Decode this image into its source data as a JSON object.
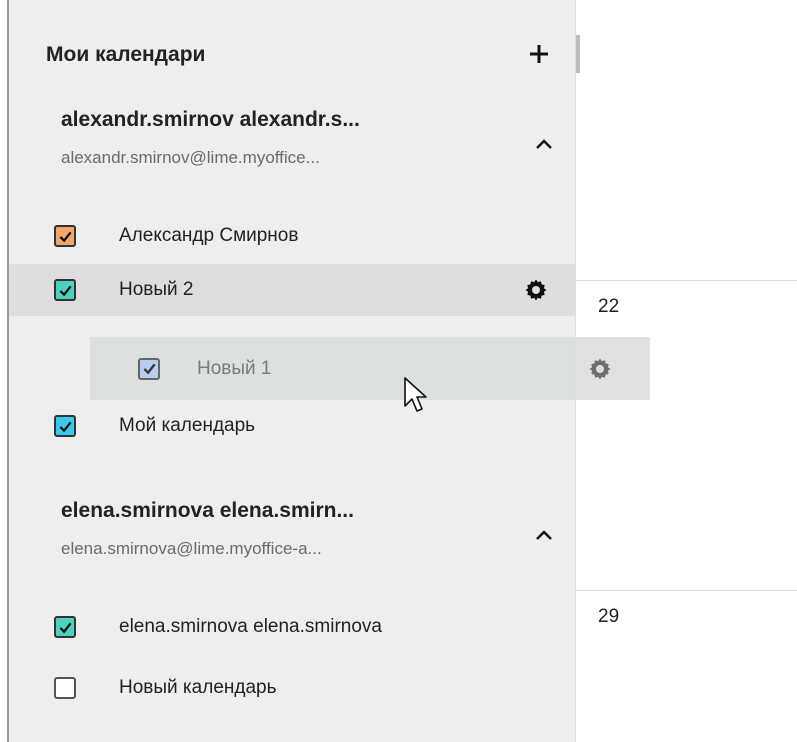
{
  "sidebar": {
    "title": "Мои календари",
    "add_icon": "plus-icon",
    "accounts": [
      {
        "name": "alexandr.smirnov alexandr.s...",
        "email": "alexandr.smirnov@lime.myoffice...",
        "collapse_icon": "chevron-up-icon",
        "calendars": [
          {
            "label": "Александр Смирнов",
            "checked": true,
            "color": "#f4a66c"
          },
          {
            "label": "Новый 2",
            "checked": true,
            "color": "#4fd1c0",
            "hovered": true,
            "settings_icon": "gear-icon"
          },
          {
            "label": "Мой календарь",
            "checked": true,
            "color": "#3ec7ec"
          }
        ]
      },
      {
        "name": "elena.smirnova elena.smirn...",
        "email": "elena.smirnova@lime.myoffice-a...",
        "collapse_icon": "chevron-up-icon",
        "calendars": [
          {
            "label": "elena.smirnova elena.smirnova",
            "checked": true,
            "color": "#4fd1c0"
          },
          {
            "label": "Новый календарь",
            "checked": false,
            "color": "#ffffff"
          }
        ]
      }
    ]
  },
  "drag_item": {
    "label": "Новый 1",
    "checked": true,
    "color": "#b9cdef",
    "settings_icon": "gear-icon"
  },
  "calendar_grid": {
    "day_numbers": [
      "22",
      "29"
    ]
  },
  "cursor_icon": "arrow-cursor-icon"
}
